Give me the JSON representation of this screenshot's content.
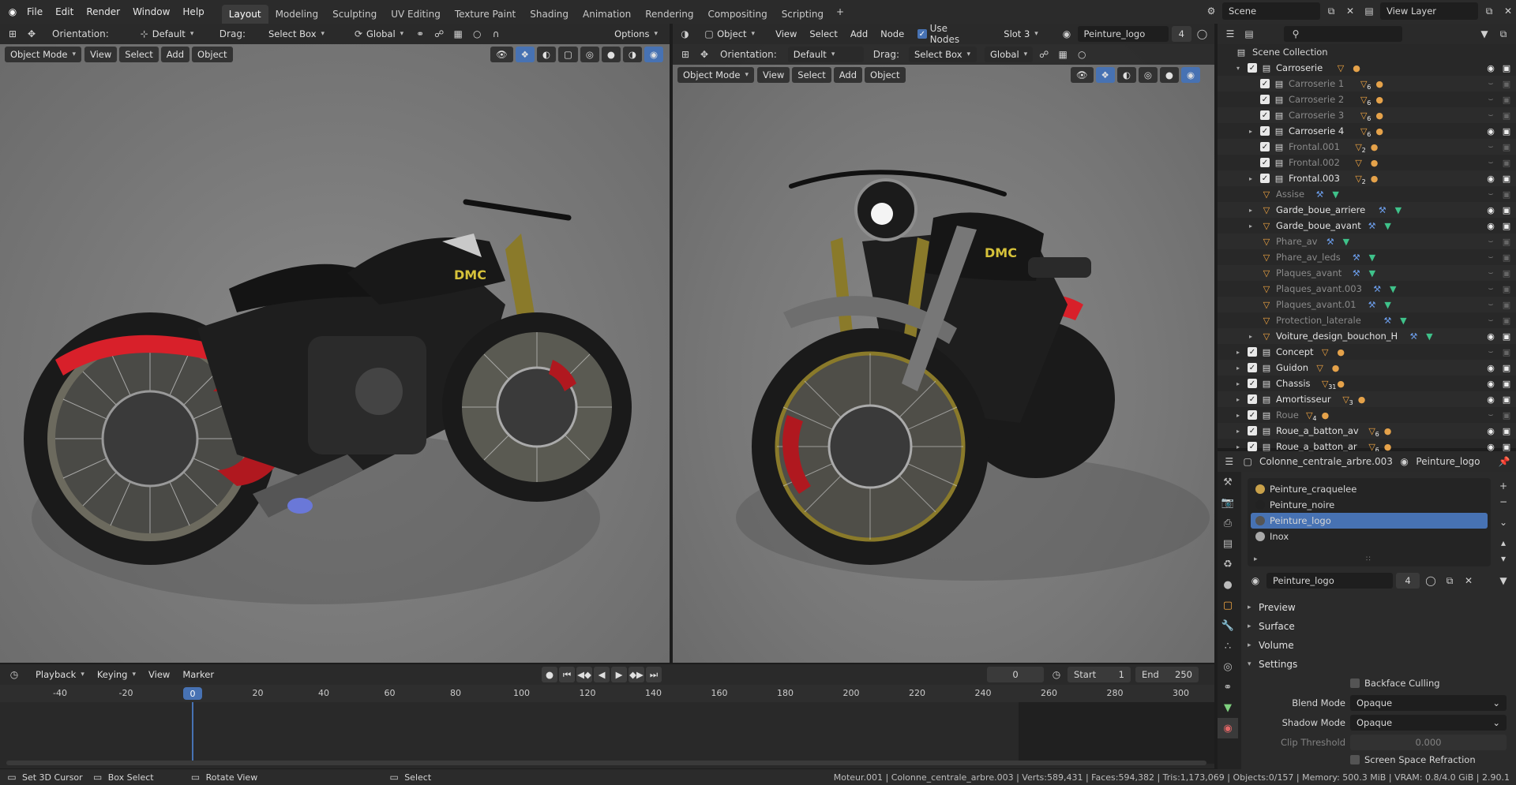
{
  "topbar": {
    "menus": [
      "File",
      "Edit",
      "Render",
      "Window",
      "Help"
    ],
    "workspaces": [
      "Layout",
      "Modeling",
      "Sculpting",
      "UV Editing",
      "Texture Paint",
      "Shading",
      "Animation",
      "Rendering",
      "Compositing",
      "Scripting"
    ],
    "active_workspace": "Layout",
    "scene": "Scene",
    "view_layer": "View Layer"
  },
  "left_header": {
    "orientation_label": "Orientation:",
    "orientation_value": "Default",
    "drag_label": "Drag:",
    "drag_value": "Select Box",
    "transform_value": "Global",
    "options": "Options"
  },
  "left_viewport": {
    "mode": "Object Mode",
    "menus": [
      "View",
      "Select",
      "Add",
      "Object"
    ]
  },
  "right_header": {
    "editor_value": "Object",
    "menus": [
      "View",
      "Select",
      "Add",
      "Node"
    ],
    "use_nodes": "Use Nodes",
    "slot": "Slot 3",
    "material": "Peinture_logo",
    "users": "4",
    "orientation_label": "Orientation:",
    "orientation_value": "Default",
    "drag_label": "Drag:",
    "drag_value": "Select Box",
    "transform_value": "Global"
  },
  "right_viewport": {
    "mode": "Object Mode",
    "menus": [
      "View",
      "Select",
      "Add",
      "Object"
    ]
  },
  "bike_logo": "DMC",
  "outliner": {
    "search_placeholder": "",
    "root": "Scene Collection",
    "rows": [
      {
        "name": "Carroserie",
        "indent": 1,
        "exp": "open",
        "kind": "coll",
        "visible": true,
        "dim": false
      },
      {
        "name": "Carroserie 1",
        "indent": 2,
        "exp": "",
        "kind": "coll",
        "visible": false,
        "dim": true,
        "badge": "6"
      },
      {
        "name": "Carroserie 2",
        "indent": 2,
        "exp": "",
        "kind": "coll",
        "visible": false,
        "dim": true,
        "badge": "6"
      },
      {
        "name": "Carroserie 3",
        "indent": 2,
        "exp": "",
        "kind": "coll",
        "visible": false,
        "dim": true,
        "badge": "6"
      },
      {
        "name": "Carroserie 4",
        "indent": 2,
        "exp": "closed",
        "kind": "coll",
        "visible": true,
        "dim": false,
        "badge": "6"
      },
      {
        "name": "Frontal.001",
        "indent": 2,
        "exp": "",
        "kind": "coll",
        "visible": false,
        "dim": true,
        "badge": "2"
      },
      {
        "name": "Frontal.002",
        "indent": 2,
        "exp": "",
        "kind": "coll",
        "visible": false,
        "dim": true,
        "badge": ""
      },
      {
        "name": "Frontal.003",
        "indent": 2,
        "exp": "closed",
        "kind": "coll",
        "visible": true,
        "dim": false,
        "badge": "2"
      },
      {
        "name": "Assise",
        "indent": 2,
        "exp": "",
        "kind": "mesh",
        "visible": false,
        "dim": true
      },
      {
        "name": "Garde_boue_arriere",
        "indent": 2,
        "exp": "closed",
        "kind": "mesh",
        "visible": true,
        "dim": false
      },
      {
        "name": "Garde_boue_avant",
        "indent": 2,
        "exp": "closed",
        "kind": "mesh",
        "visible": true,
        "dim": false
      },
      {
        "name": "Phare_av",
        "indent": 2,
        "exp": "",
        "kind": "mesh",
        "visible": false,
        "dim": true
      },
      {
        "name": "Phare_av_leds",
        "indent": 2,
        "exp": "",
        "kind": "mesh",
        "visible": false,
        "dim": true
      },
      {
        "name": "Plaques_avant",
        "indent": 2,
        "exp": "",
        "kind": "mesh",
        "visible": false,
        "dim": true
      },
      {
        "name": "Plaques_avant.003",
        "indent": 2,
        "exp": "",
        "kind": "mesh",
        "visible": false,
        "dim": true
      },
      {
        "name": "Plaques_avant.01",
        "indent": 2,
        "exp": "",
        "kind": "mesh",
        "visible": false,
        "dim": true
      },
      {
        "name": "Protection_laterale",
        "indent": 2,
        "exp": "",
        "kind": "mesh",
        "visible": false,
        "dim": true
      },
      {
        "name": "Voiture_design_bouchon_H",
        "indent": 2,
        "exp": "closed",
        "kind": "mesh",
        "visible": true,
        "dim": false
      },
      {
        "name": "Concept",
        "indent": 1,
        "exp": "closed",
        "kind": "coll",
        "visible": false,
        "dim": false
      },
      {
        "name": "Guidon",
        "indent": 1,
        "exp": "closed",
        "kind": "coll",
        "visible": true,
        "dim": false
      },
      {
        "name": "Chassis",
        "indent": 1,
        "exp": "closed",
        "kind": "coll",
        "visible": true,
        "dim": false,
        "badge": "31"
      },
      {
        "name": "Amortisseur",
        "indent": 1,
        "exp": "closed",
        "kind": "coll",
        "visible": true,
        "dim": false,
        "badge": "3"
      },
      {
        "name": "Roue",
        "indent": 1,
        "exp": "closed",
        "kind": "coll",
        "visible": false,
        "dim": true,
        "badge": "4"
      },
      {
        "name": "Roue_a_batton_av",
        "indent": 1,
        "exp": "closed",
        "kind": "coll",
        "visible": true,
        "dim": false,
        "badge": "6"
      },
      {
        "name": "Roue_a_batton_ar",
        "indent": 1,
        "exp": "closed",
        "kind": "coll",
        "visible": true,
        "dim": false,
        "badge": "6"
      }
    ]
  },
  "properties": {
    "object": "Colonne_centrale_arbre.003",
    "material_tab": "Peinture_logo",
    "slots": [
      "Peinture_craquelee",
      "Peinture_noire",
      "Peinture_logo",
      "Inox"
    ],
    "active_slot": "Peinture_logo",
    "material": "Peinture_logo",
    "users": "4",
    "panels": [
      "Preview",
      "Surface",
      "Volume",
      "Settings"
    ],
    "backface_culling": "Backface Culling",
    "blend_mode_label": "Blend Mode",
    "blend_mode": "Opaque",
    "shadow_mode_label": "Shadow Mode",
    "shadow_mode": "Opaque",
    "clip_threshold_label": "Clip Threshold",
    "clip_threshold": "0.000",
    "ssr": "Screen Space Refraction"
  },
  "timeline": {
    "menus": [
      "Playback",
      "Keying",
      "View",
      "Marker"
    ],
    "current_frame": "0",
    "start_label": "Start",
    "start": "1",
    "end_label": "End",
    "end": "250",
    "ticks": [
      "-40",
      "-20",
      "0",
      "20",
      "40",
      "60",
      "80",
      "100",
      "120",
      "140",
      "160",
      "180",
      "200",
      "220",
      "240",
      "260",
      "280",
      "300"
    ]
  },
  "status": {
    "hint1": "Set 3D Cursor",
    "hint2": "Box Select",
    "hint3": "Rotate View",
    "hint4": "Select",
    "stats": "Moteur.001 | Colonne_centrale_arbre.003 | Verts:589,431 | Faces:594,382 | Tris:1,173,069 | Objects:0/157 | Memory: 500.3 MiB | VRAM: 0.8/4.0 GiB | 2.90.1"
  },
  "colors": {
    "accent": "#4772b3",
    "collection": "#e8e8e8",
    "mesh": "#f4a742",
    "modifier": "#6b9ce8",
    "fender": "#d8202a"
  }
}
